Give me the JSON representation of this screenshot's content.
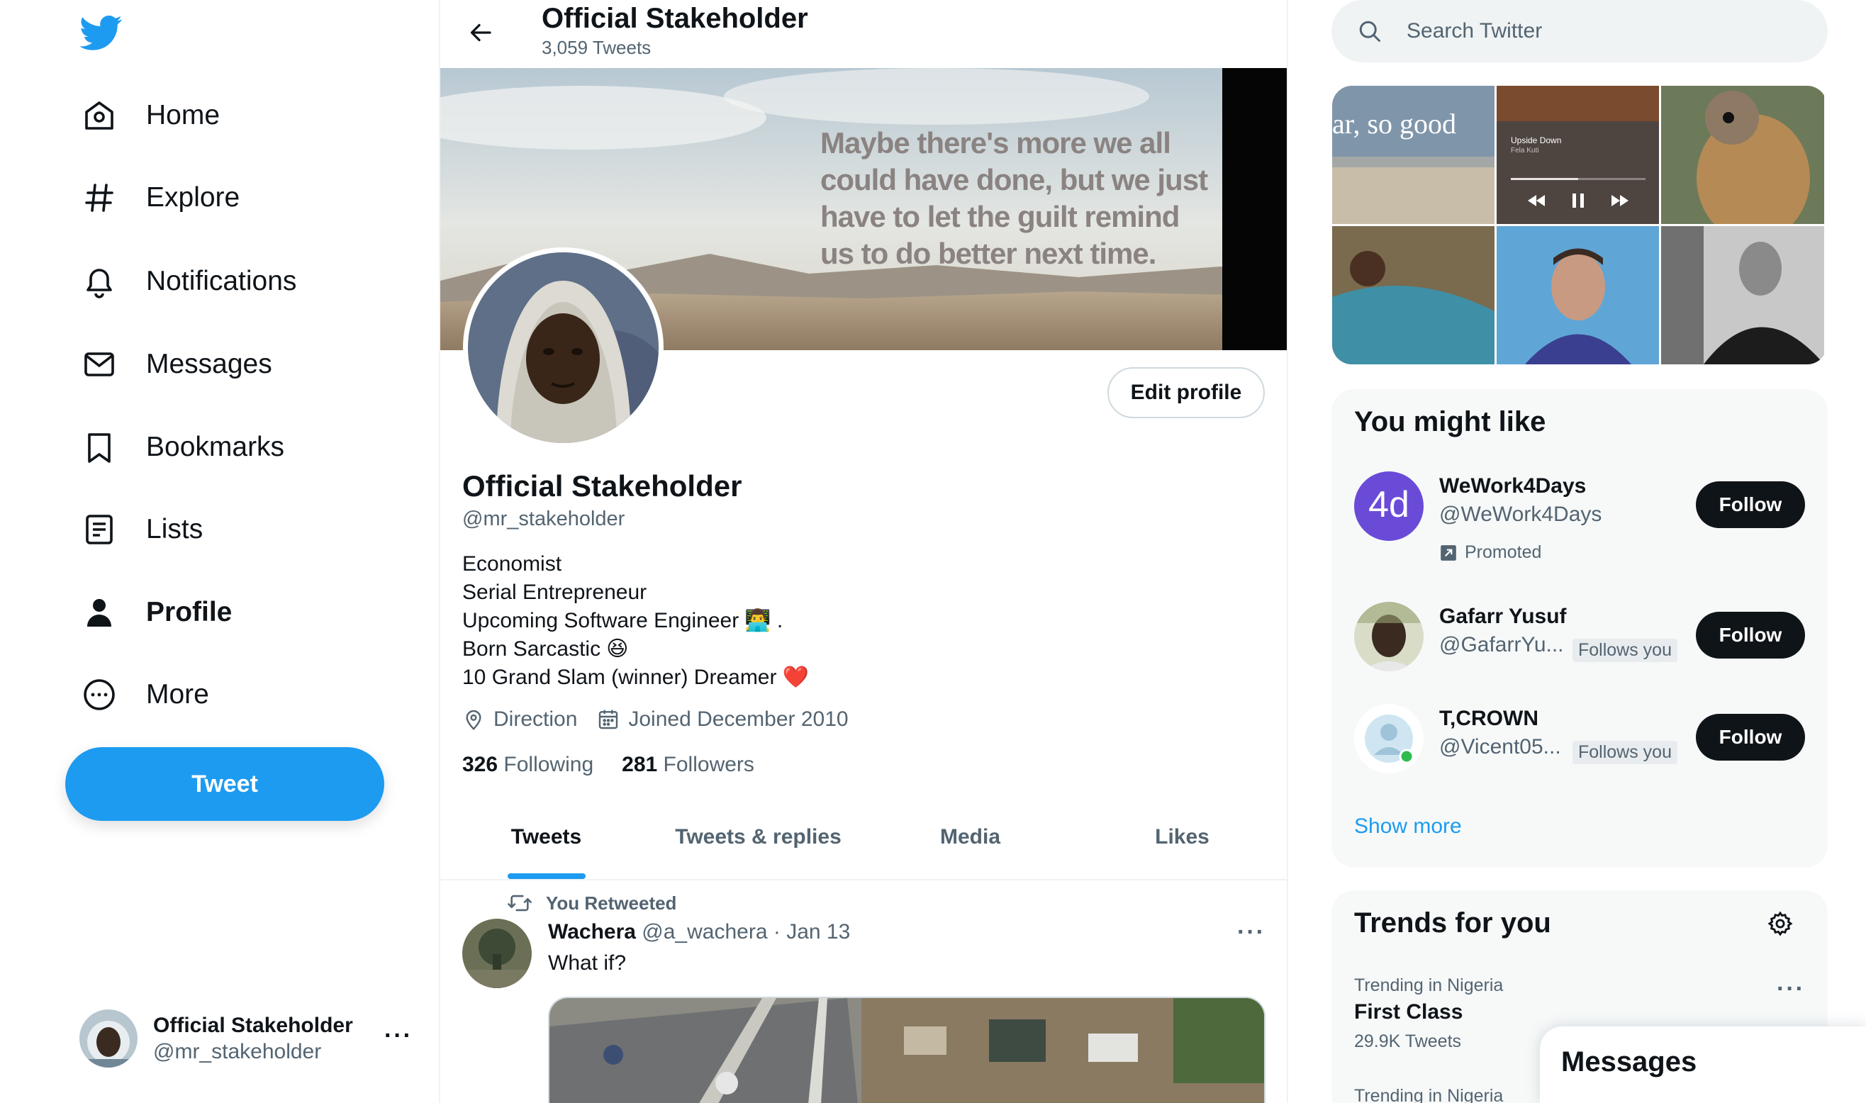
{
  "brand": {
    "color": "#1d9bf0",
    "logo_icon": "twitter-bird-icon"
  },
  "sidebar": {
    "items": [
      {
        "label": "Home",
        "icon": "home-icon"
      },
      {
        "label": "Explore",
        "icon": "hashtag-icon"
      },
      {
        "label": "Notifications",
        "icon": "bell-icon"
      },
      {
        "label": "Messages",
        "icon": "envelope-icon"
      },
      {
        "label": "Bookmarks",
        "icon": "bookmark-icon"
      },
      {
        "label": "Lists",
        "icon": "list-icon"
      },
      {
        "label": "Profile",
        "icon": "person-icon",
        "active": true
      },
      {
        "label": "More",
        "icon": "more-circle-icon"
      }
    ],
    "tweet_label": "Tweet",
    "account": {
      "name": "Official Stakeholder",
      "handle": "@mr_stakeholder",
      "more": "···"
    }
  },
  "header": {
    "title": "Official Stakeholder",
    "tweet_count": "3,059 Tweets"
  },
  "banner": {
    "quote": "Maybe there's more we all could have done, but we just have to let the guilt remind us to do better next time."
  },
  "profile": {
    "edit_label": "Edit profile",
    "name": "Official Stakeholder",
    "handle": "@mr_stakeholder",
    "bio": [
      {
        "text": "Economist",
        "emoji": ""
      },
      {
        "text": "Serial Entrepreneur",
        "emoji": ""
      },
      {
        "text": "Upcoming Software Engineer",
        "emoji": "👨‍💻 ."
      },
      {
        "text": "Born Sarcastic",
        "emoji": "😆"
      },
      {
        "text": "10 Grand Slam (winner) Dreamer",
        "emoji": "❤️"
      }
    ],
    "location": "Direction",
    "joined": "Joined December 2010",
    "following_count": "326",
    "following_label": "Following",
    "followers_count": "281",
    "followers_label": "Followers"
  },
  "tabs": [
    {
      "label": "Tweets",
      "active": true
    },
    {
      "label": "Tweets & replies"
    },
    {
      "label": "Media"
    },
    {
      "label": "Likes"
    }
  ],
  "tweet": {
    "context": "You Retweeted",
    "author_name": "Wachera",
    "author_handle": "@a_wachera",
    "separator": "·",
    "date": "Jan 13",
    "text": "What if?",
    "more": "···"
  },
  "search": {
    "placeholder": "Search Twitter"
  },
  "media_grid": {
    "first_cell_text": "ar, so good",
    "player_title": "Upside Down",
    "player_artist": "Fela Kuti"
  },
  "who_to_follow": {
    "title": "You might like",
    "follow_label": "Follow",
    "follows_you_label": "Follows you",
    "promoted_label": "Promoted",
    "show_more": "Show more",
    "accounts": [
      {
        "name": "WeWork4Days",
        "handle": "@WeWork4Days",
        "avatar_text": "4d",
        "avatar_color": "#6a4bd8"
      },
      {
        "name": "Gafarr Yusuf",
        "handle": "@GafarrYu..."
      },
      {
        "name": "T,CROWN",
        "handle": "@Vicent05..."
      }
    ]
  },
  "trends": {
    "title": "Trends for you",
    "items": [
      {
        "context": "Trending in Nigeria",
        "name": "First Class",
        "count": "29.9K Tweets"
      },
      {
        "context": "Trending in Nigeria"
      }
    ]
  },
  "messages_drawer": {
    "title": "Messages"
  }
}
